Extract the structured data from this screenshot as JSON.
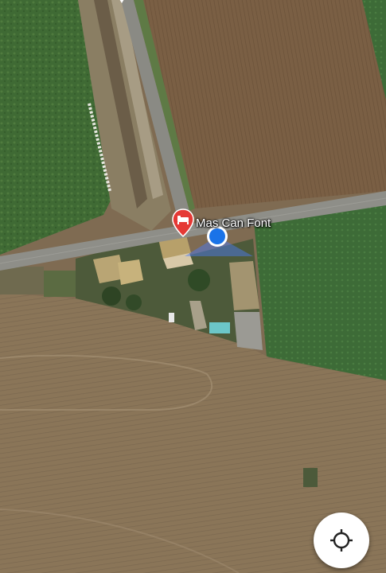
{
  "map": {
    "place_name": "Mas Can Font",
    "icons": {
      "pin": "hotel-pin-icon",
      "user_location": "blue-dot-icon",
      "locate_button": "my-location-icon"
    },
    "colors": {
      "pin_red": "#e53935",
      "user_dot": "#1a73e8",
      "heading_cone": "#4a7dff",
      "road": "#8e8e88"
    }
  }
}
